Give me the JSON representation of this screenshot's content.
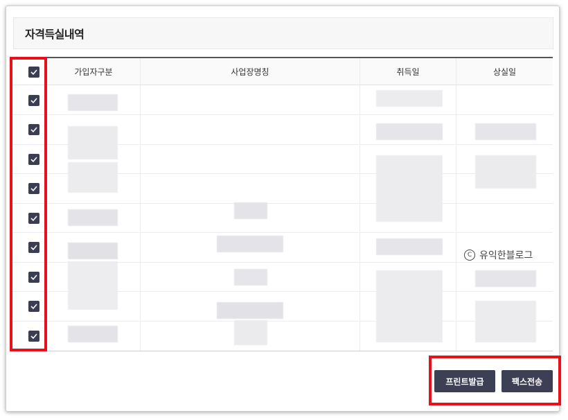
{
  "dialog": {
    "title": "자격득실내역"
  },
  "table": {
    "columns": [
      "가입자구분",
      "사업장명칭",
      "취득일",
      "상실일"
    ],
    "rows_checked": [
      true,
      true,
      true,
      true,
      true,
      true,
      true,
      true,
      true,
      true
    ]
  },
  "buttons": {
    "print_label": "프린트발급",
    "fax_label": "팩스전송"
  },
  "watermark": {
    "symbol": "C",
    "text": "유익한블로그"
  },
  "colors": {
    "checkbox": "#3b3d52",
    "button": "#3d3f55",
    "highlight": "#e8101a"
  }
}
